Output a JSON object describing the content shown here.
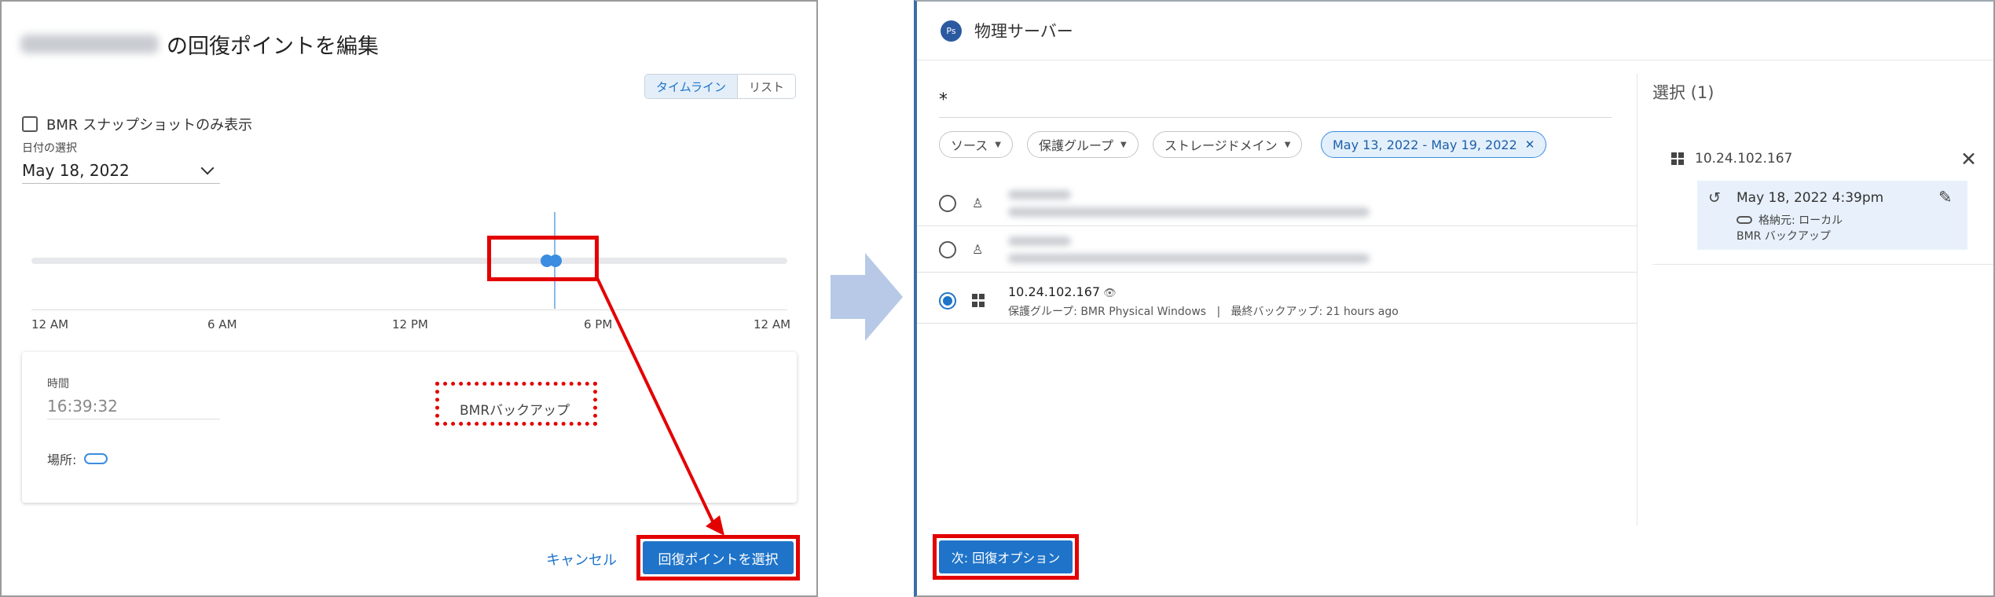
{
  "edit_dialog": {
    "title_suffix": "の回復ポイントを編集",
    "view_toggle": {
      "timeline": "タイムライン",
      "list": "リスト"
    },
    "bmr_only_label": "BMR スナップショットのみ表示",
    "date_label": "日付の選択",
    "date_value": "May 18, 2022",
    "axis_ticks": [
      "12 AM",
      "6 AM",
      "12 PM",
      "6 PM",
      "12 AM"
    ],
    "detail": {
      "time_label": "時間",
      "time_value": "16:39:32",
      "backup_type": "BMRバックアップ",
      "location_label": "場所:"
    },
    "cancel_label": "キャンセル",
    "select_label": "回復ポイントを選択"
  },
  "server_dialog": {
    "badge": "Ps",
    "title": "物理サーバー",
    "search_value": "*",
    "filters": {
      "source": "ソース",
      "protection_group": "保護グループ",
      "storage_domain": "ストレージドメイン",
      "date_range": "May 13, 2022 - May 19, 2022"
    },
    "rows": [
      {
        "name": "10.24.102.167",
        "protection_group": "保護グループ:  BMR Physical Windows",
        "last_backup": "最終バックアップ: 21 hours ago"
      }
    ],
    "selection": {
      "title": "選択 (1)",
      "host": "10.24.102.167",
      "snapshot_time": "May 18, 2022 4:39pm",
      "storage": "格納元: ローカル",
      "backup_type": "BMR バックアップ"
    },
    "next_label": "次: 回復オプション"
  },
  "icons": {
    "windows": "windows-icon",
    "linux": "linux-icon",
    "history": "history-icon",
    "edit": "pencil-icon",
    "close": "close-icon"
  },
  "colors": {
    "primary": "#1f74c9",
    "highlight_red": "#e30000",
    "selection_bg": "#e8f1fb"
  }
}
